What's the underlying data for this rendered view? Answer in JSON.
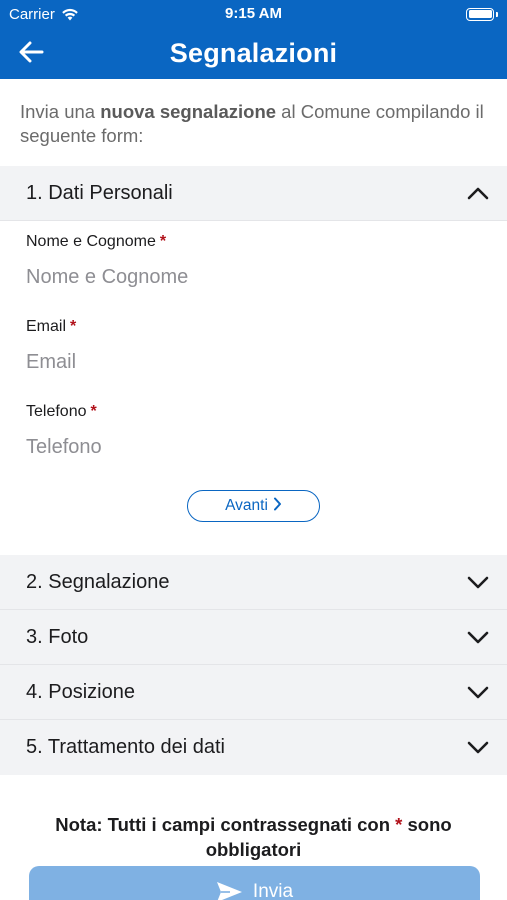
{
  "status": {
    "carrier": "Carrier",
    "time": "9:15 AM",
    "battery_level": 1.0
  },
  "header": {
    "title": "Segnalazioni",
    "back_icon": "arrow-left-icon"
  },
  "intro": {
    "before": "Invia una ",
    "bold": "nuova segnalazione",
    "after": " al Comune compilando il seguente form:"
  },
  "sections": [
    {
      "title": "1. Dati Personali",
      "expanded": true
    },
    {
      "title": "2. Segnalazione",
      "expanded": false
    },
    {
      "title": "3. Foto",
      "expanded": false
    },
    {
      "title": "4. Posizione",
      "expanded": false
    },
    {
      "title": "5. Trattamento dei dati",
      "expanded": false
    }
  ],
  "fields": [
    {
      "label": "Nome e Cognome",
      "required_mark": "*",
      "value": "",
      "placeholder": "Nome e Cognome"
    },
    {
      "label": "Email",
      "required_mark": "*",
      "value": "",
      "placeholder": "Email"
    },
    {
      "label": "Telefono",
      "required_mark": "*",
      "value": "",
      "placeholder": "Telefono"
    }
  ],
  "next_button": {
    "label": "Avanti"
  },
  "note": {
    "before": "Nota: Tutti i campi contrassegnati con ",
    "mark": "*",
    "after": " sono obbligatori"
  },
  "submit_button": {
    "label": "Invia",
    "icon": "send-icon"
  },
  "colors": {
    "brand": "#0a66c2",
    "required": "#b1111a",
    "submit_disabled": "#7fb1e3"
  }
}
